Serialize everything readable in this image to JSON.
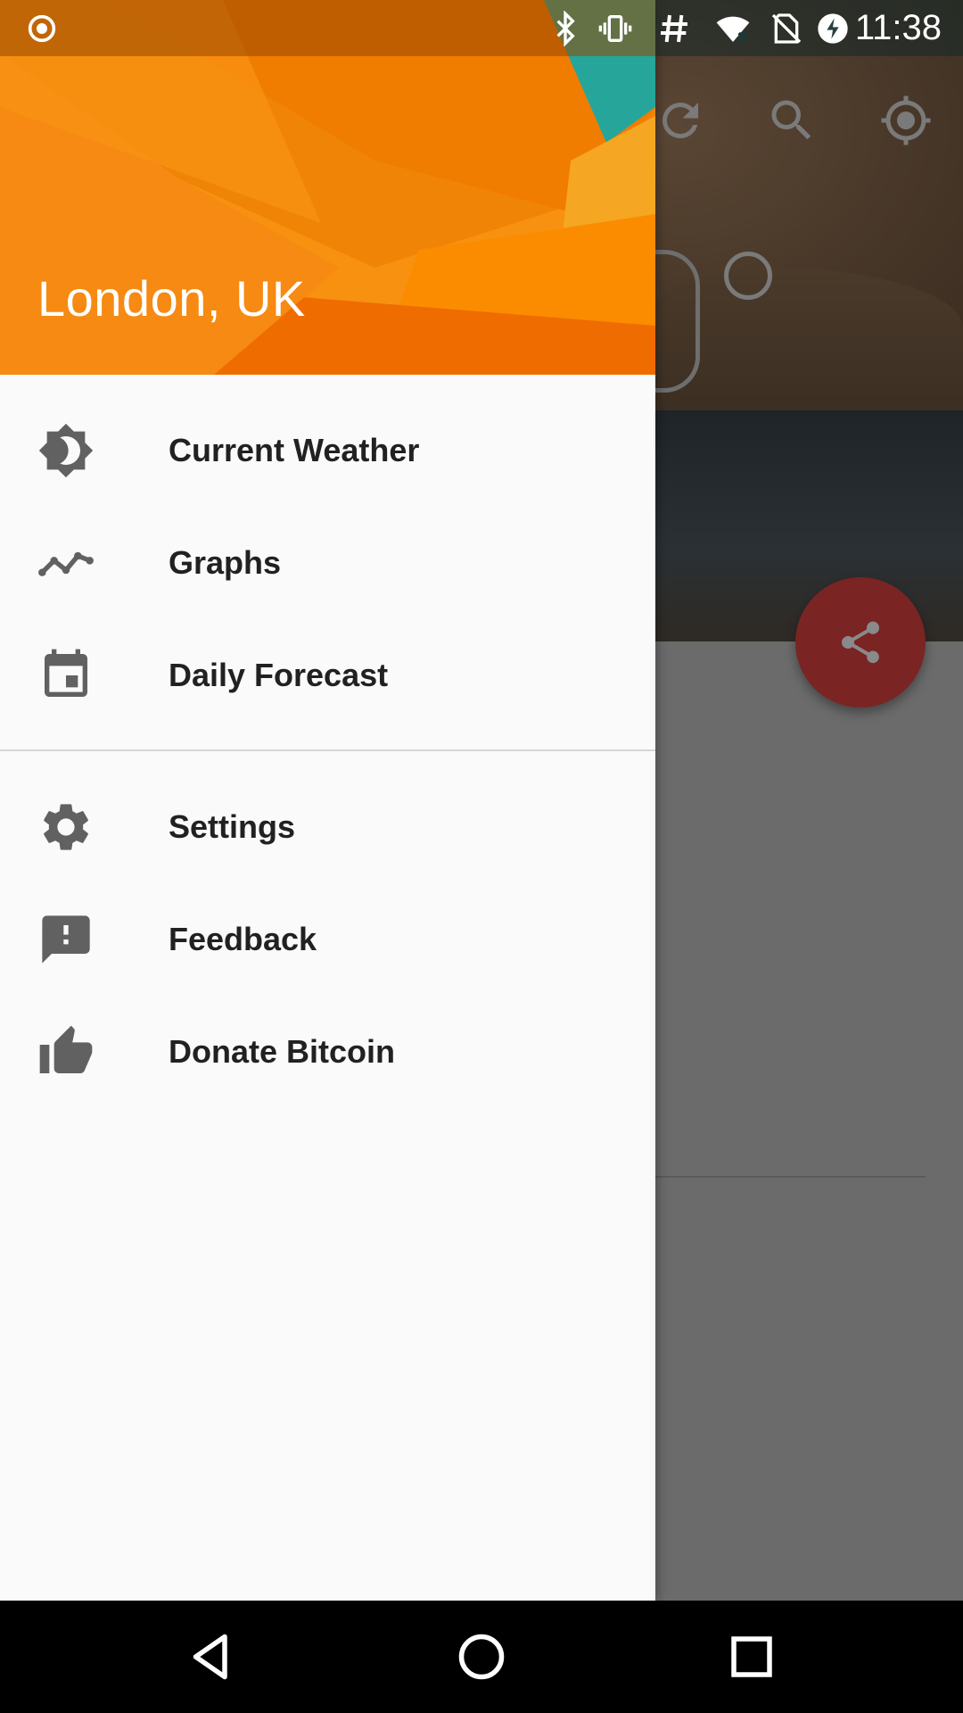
{
  "status_bar": {
    "time": "11:38",
    "icons": [
      "record-icon",
      "bluetooth-icon",
      "vibrate-icon",
      "hashtag-icon",
      "wifi-icon",
      "no-sim-icon",
      "battery-charging-icon"
    ]
  },
  "drawer": {
    "header": {
      "location": "London, UK",
      "colors": {
        "primary": "#f48a0c",
        "accent": "#26a69a"
      }
    },
    "primary_items": [
      {
        "label": "Current Weather",
        "icon": "day-night-icon"
      },
      {
        "label": "Graphs",
        "icon": "trending-line-icon"
      },
      {
        "label": "Daily Forecast",
        "icon": "calendar-icon"
      }
    ],
    "secondary_items": [
      {
        "label": "Settings",
        "icon": "gear-icon"
      },
      {
        "label": "Feedback",
        "icon": "feedback-icon"
      },
      {
        "label": "Donate Bitcoin",
        "icon": "thumbs-up-icon"
      }
    ]
  },
  "background_app": {
    "toolbar_icons": [
      "refresh-icon",
      "search-icon",
      "my-location-icon"
    ],
    "fab_icon": "share-icon",
    "fab_color": "#7a2424"
  },
  "nav_bar": {
    "buttons": [
      "back-icon",
      "home-icon",
      "recents-icon"
    ]
  }
}
